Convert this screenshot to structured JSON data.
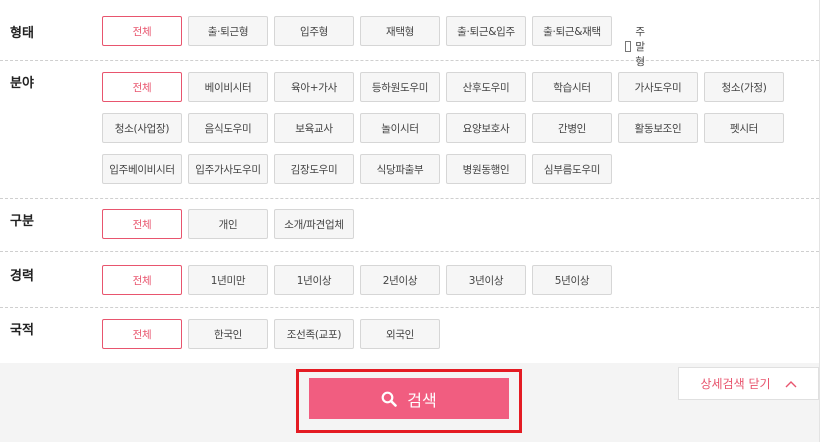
{
  "filters": {
    "type": {
      "label": "형태",
      "options": [
        "전체",
        "출·퇴근형",
        "입주형",
        "재택형",
        "출·퇴근&입주",
        "출·퇴근&재택"
      ],
      "checkbox_label": "주말형"
    },
    "field": {
      "label": "분야",
      "options": [
        "전체",
        "베이비시터",
        "육아+가사",
        "등하원도우미",
        "산후도우미",
        "학습시터",
        "가사도우미",
        "청소(가정)",
        "청소(사업장)",
        "음식도우미",
        "보육교사",
        "놀이시터",
        "요양보호사",
        "간병인",
        "활동보조인",
        "펫시터",
        "입주베이비시터",
        "입주가사도우미",
        "김장도우미",
        "식당파출부",
        "병원동행인",
        "심부름도우미"
      ]
    },
    "category": {
      "label": "구분",
      "options": [
        "전체",
        "개인",
        "소개/파견업체"
      ]
    },
    "career": {
      "label": "경력",
      "options": [
        "전체",
        "1년미만",
        "1년이상",
        "2년이상",
        "3년이상",
        "5년이상"
      ]
    },
    "nationality": {
      "label": "국적",
      "options": [
        "전체",
        "한국인",
        "조선족(교포)",
        "외국인"
      ]
    }
  },
  "active_option": "전체",
  "search_button": {
    "label": "검색"
  },
  "close_detail": {
    "label": "상세검색 닫기"
  },
  "colors": {
    "accent": "#e8556e",
    "button": "#f15d80",
    "highlight": "#e41b23"
  },
  "icons": {
    "search": "search-icon",
    "close": "chevron-up-icon"
  }
}
